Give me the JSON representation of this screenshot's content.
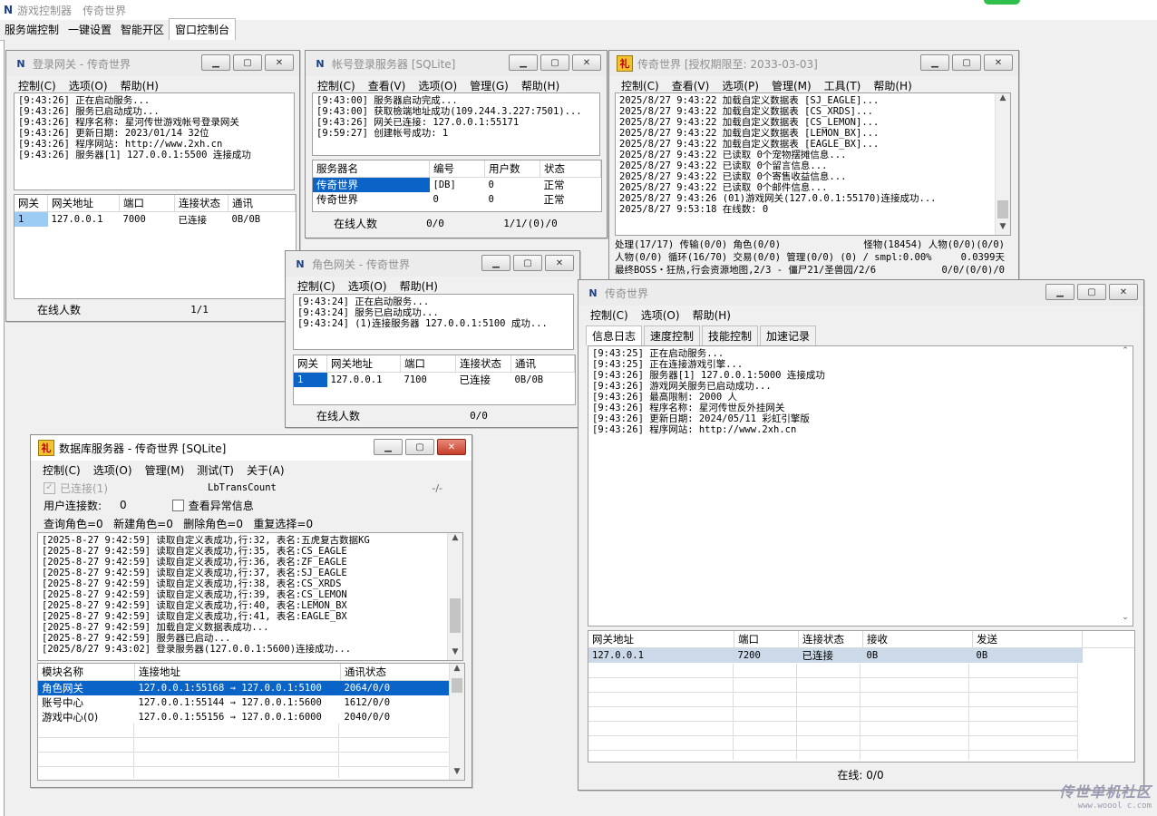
{
  "app": {
    "title": "游戏控制器",
    "subtitle": "传奇世界"
  },
  "main_tabs": [
    "服务端控制",
    "一键设置",
    "智能开区",
    "窗口控制台"
  ],
  "login_gate": {
    "title": "登录网关 - 传奇世界",
    "menu": [
      "控制(C)",
      "选项(O)",
      "帮助(H)"
    ],
    "log": [
      "[9:43:26] 正在启动服务...",
      "[9:43:26] 服务已启动成功...",
      "[9:43:26] 程序名称: 星河传世游戏帐号登录网关",
      "[9:43:26] 更新日期: 2023/01/14 32位",
      "[9:43:26] 程序网站: http://www.2xh.cn",
      "[9:43:26] 服务器[1] 127.0.0.1:5500 连接成功"
    ],
    "columns": [
      "网关",
      "网关地址",
      "端口",
      "连接状态",
      "通讯"
    ],
    "rows": [
      [
        "1",
        "127.0.0.1",
        "7000",
        "已连接",
        "0B/0B"
      ]
    ],
    "status_label": "在线人数",
    "status_value": "1/1"
  },
  "account_server": {
    "title": "帐号登录服务器 [SQLite]",
    "menu": [
      "控制(C)",
      "查看(V)",
      "选项(O)",
      "管理(G)",
      "帮助(H)"
    ],
    "log": [
      "[9:43:00] 服务器启动完成...",
      "[9:43:00] 获取檢端地址成功(109.244.3.227:7501)...",
      "[9:43:26] 网关已连接: 127.0.0.1:55171",
      "[9:59:27] 创建帐号成功: 1"
    ],
    "columns": [
      "服务器名",
      "编号",
      "用户数",
      "状态"
    ],
    "rows": [
      [
        "传奇世界",
        "[DB]",
        "0",
        "正常"
      ],
      [
        "传奇世界",
        "0",
        "0",
        "正常"
      ]
    ],
    "status_label": "在线人数",
    "status_a": "0/0",
    "status_b": "1/1/(0)/0"
  },
  "game_world": {
    "title": "传奇世界 [授权期限至: 2033-03-03]",
    "menu": [
      "控制(C)",
      "查看(V)",
      "选项(P)",
      "管理(M)",
      "工具(T)",
      "帮助(H)"
    ],
    "log": [
      "2025/8/27 9:43:22 加载自定义数据表 [SJ_EAGLE]...",
      "2025/8/27 9:43:22 加载自定义数据表 [CS_XRDS]...",
      "2025/8/27 9:43:22 加载自定义数据表 [CS_LEMON]...",
      "2025/8/27 9:43:22 加载自定义数据表 [LEMON_BX]...",
      "2025/8/27 9:43:22 加载自定义数据表 [EAGLE_BX]...",
      "2025/8/27 9:43:22 已读取 0个宠物摆摊信息...",
      "2025/8/27 9:43:22 已读取 0个留言信息...",
      "2025/8/27 9:43:22 已读取 0个寄售收益信息...",
      "2025/8/27 9:43:22 已读取 0个邮件信息...",
      "2025/8/27 9:43:26 (01)游戏网关(127.0.0.1:55170)连接成功...",
      "2025/8/27 9:53:18 在线数: 0"
    ],
    "stats": [
      [
        "处理(17/17) 传输(0/0) 角色(0/0)",
        "怪物(18454) 人物(0/0)(0/0)"
      ],
      [
        "人物(0/0) 循环(16/70) 交易(0/0) 管理(0/0) (0) / smpl:0.00%",
        "0.0399天"
      ],
      [
        "最终BOSS・狂热,行会资源地图,2/3 - 僵尸21/圣兽园/2/6",
        "0/0/(0/0)/0"
      ]
    ]
  },
  "role_gate": {
    "title": "角色网关 - 传奇世界",
    "menu": [
      "控制(C)",
      "选项(O)",
      "帮助(H)"
    ],
    "log": [
      "[9:43:24] 正在启动服务...",
      "[9:43:24] 服务已启动成功...",
      "[9:43:24] (1)连接服务器 127.0.0.1:5100 成功..."
    ],
    "columns": [
      "网关",
      "网关地址",
      "端口",
      "连接状态",
      "通讯"
    ],
    "rows": [
      [
        "1",
        "127.0.0.1",
        "7100",
        "已连接",
        "0B/0B"
      ]
    ],
    "status_label": "在线人数",
    "status_value": "0/0"
  },
  "game_gate": {
    "title": "传奇世界",
    "menu": [
      "控制(C)",
      "选项(O)",
      "帮助(H)"
    ],
    "tabs": [
      "信息日志",
      "速度控制",
      "技能控制",
      "加速记录"
    ],
    "log": [
      "[9:43:25] 正在启动服务...",
      "[9:43:25] 正在连接游戏引擎...",
      "[9:43:26] 服务器[1] 127.0.0.1:5000 连接成功",
      "[9:43:26] 游戏网关服务已启动成功...",
      "[9:43:26] 最高限制: 2000 人",
      "[9:43:26] 程序名称: 星河传世反外挂网关",
      "[9:43:26] 更新日期: 2024/05/11 彩虹引擎版",
      "[9:43:26] 程序网站: http://www.2xh.cn"
    ],
    "columns": [
      "网关地址",
      "端口",
      "连接状态",
      "接收",
      "发送"
    ],
    "rows": [
      [
        "127.0.0.1",
        "7200",
        "已连接",
        "0B",
        "0B"
      ]
    ],
    "status": "在线: 0/0"
  },
  "db_server": {
    "title": "数据库服务器 - 传奇世界 [SQLite]",
    "menu": [
      "控制(C)",
      "选项(O)",
      "管理(M)",
      "测试(T)",
      "关于(A)"
    ],
    "connected_label": "已连接(1)",
    "lbtrans": "LbTransCount",
    "lbtrans_value": "-/-",
    "user_conn_label": "用户连接数:",
    "user_conn_value": "0",
    "check_abnormal": "查看异常信息",
    "counters": "查询角色=0   新建角色=0   删除角色=0   重复选择=0",
    "log": [
      "[2025-8-27 9:42:59] 读取自定义表成功,行:32, 表名:五虎复古数据KG",
      "[2025-8-27 9:42:59] 读取自定义表成功,行:35, 表名:CS_EAGLE",
      "[2025-8-27 9:42:59] 读取自定义表成功,行:36, 表名:ZF_EAGLE",
      "[2025-8-27 9:42:59] 读取自定义表成功,行:37, 表名:SJ_EAGLE",
      "[2025-8-27 9:42:59] 读取自定义表成功,行:38, 表名:CS_XRDS",
      "[2025-8-27 9:42:59] 读取自定义表成功,行:39, 表名:CS_LEMON",
      "[2025-8-27 9:42:59] 读取自定义表成功,行:40, 表名:LEMON_BX",
      "[2025-8-27 9:42:59] 读取自定义表成功,行:41, 表名:EAGLE_BX",
      "[2025-8-27 9:42:59] 加载自定义数据表成功...",
      "[2025-8-27 9:42:59] 服务器已启动...",
      "[2025/8/27 9:43:02] 登录服务器(127.0.0.1:5600)连接成功..."
    ],
    "columns": [
      "模块名称",
      "连接地址",
      "通讯状态"
    ],
    "rows": [
      [
        "角色网关",
        "127.0.0.1:55168 → 127.0.0.1:5100",
        "2064/0/0"
      ],
      [
        "账号中心",
        "127.0.0.1:55144 → 127.0.0.1:5600",
        "1612/0/0"
      ],
      [
        "游戏中心(0)",
        "127.0.0.1:55156 → 127.0.0.1:6000",
        "2040/0/0"
      ]
    ]
  },
  "watermark": {
    "line1": "传世单机社区",
    "line2": "www.woool c.com"
  }
}
